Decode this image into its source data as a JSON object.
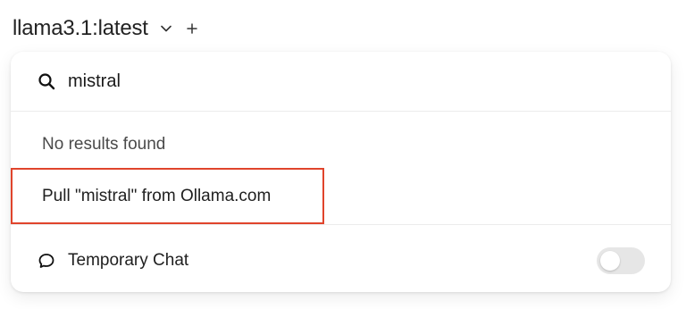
{
  "header": {
    "model_name": "llama3.1:latest",
    "chevron_icon": "chevron-down-icon",
    "plus_icon": "plus-icon"
  },
  "dropdown": {
    "search": {
      "icon": "search-icon",
      "value": "mistral",
      "placeholder": ""
    },
    "no_results_text": "No results found",
    "pull_item_label": "Pull \"mistral\" from Ollama.com",
    "highlight_color": "#e0442c",
    "temporary_chat": {
      "icon": "chat-bubble-icon",
      "label": "Temporary Chat",
      "enabled": false
    }
  }
}
